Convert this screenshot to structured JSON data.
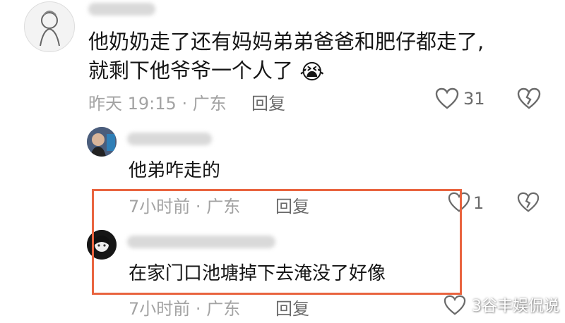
{
  "comments": [
    {
      "lines": [
        "他奶奶走了还有妈妈弟弟爸爸和肥仔都走了,",
        "就剩下他爷爷一个人了"
      ],
      "emoji": "😭",
      "time": "昨天 19:15",
      "location": "广东",
      "reply_label": "回复",
      "likes": "31"
    }
  ],
  "replies": [
    {
      "text": "他弟咋走的",
      "time": "7小时前",
      "location": "广东",
      "reply_label": "回复",
      "likes": "1"
    },
    {
      "text": "在家门口池塘掉下去淹没了好像",
      "time": "7小时前",
      "location": "广东",
      "reply_label": "回复",
      "likes": ""
    }
  ],
  "separator": "·",
  "watermark": "3谷丰娱侃说",
  "colors": {
    "highlight_border": "#e9643f",
    "meta_text": "#a3a3a3",
    "body_text": "#161616"
  }
}
